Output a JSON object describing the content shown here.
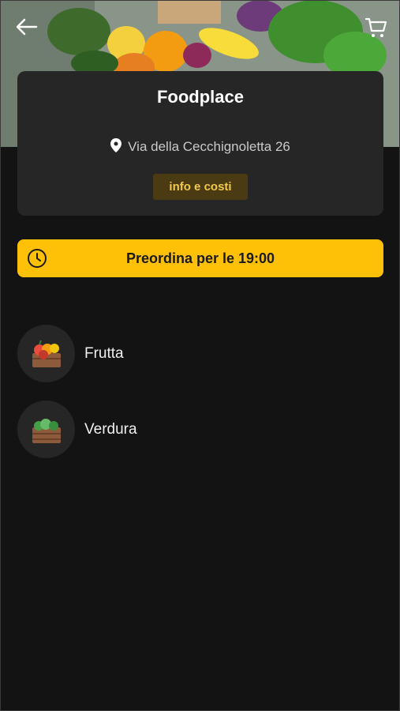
{
  "header": {
    "back_icon": "arrow-left-icon",
    "cart_icon": "shopping-cart-icon"
  },
  "store": {
    "name": "Foodplace",
    "address": "Via della Cecchignoletta 26",
    "address_icon": "map-pin-icon",
    "info_button": "info e costi"
  },
  "preorder": {
    "label": "Preordina per le",
    "time": "19:00",
    "icon": "clock-icon",
    "color": "#ffc107"
  },
  "categories": [
    {
      "label": "Frutta",
      "icon": "fruit-crate-icon"
    },
    {
      "label": "Verdura",
      "icon": "vegetable-crate-icon"
    }
  ],
  "colors": {
    "background": "#131313",
    "card": "#262626",
    "accent": "#ffc107",
    "info_button_bg": "#4a3b12",
    "info_button_text": "#f2c94c"
  }
}
